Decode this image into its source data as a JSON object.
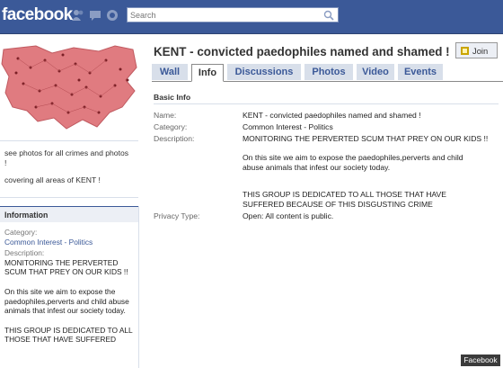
{
  "topbar": {
    "logo": "facebook",
    "search": {
      "placeholder": "Search"
    }
  },
  "sidebar": {
    "description_lines": [
      "see photos for all crimes and photos !",
      "covering all areas of KENT !"
    ],
    "info_heading": "Information",
    "category_label": "Category:",
    "category_value": "Common Interest - Politics",
    "description_label": "Description:",
    "description_paragraphs": [
      "MONITORING THE PERVERTED SCUM THAT PREY ON OUR KIDS !!",
      "On this site we aim to expose the paedophiles,perverts and child abuse animals that infest our society today.",
      "THIS GROUP IS DEDICATED TO ALL THOSE THAT HAVE SUFFERED"
    ]
  },
  "main": {
    "title": "KENT - convicted paedophiles named and shamed !",
    "join_label": "Join",
    "tabs": [
      {
        "label": "Wall"
      },
      {
        "label": "Info"
      },
      {
        "label": "Discussions"
      },
      {
        "label": "Photos"
      },
      {
        "label": "Video"
      },
      {
        "label": "Events"
      }
    ],
    "active_tab": "Info",
    "section_title": "Basic Info",
    "fields": {
      "name_label": "Name:",
      "name_value": "KENT - convicted paedophiles named and shamed !",
      "category_label": "Category:",
      "category_value": "Common Interest - Politics",
      "description_label": "Description:",
      "description_p1": "MONITORING THE PERVERTED SCUM THAT PREY ON OUR KIDS !!",
      "description_p2": "On this site we aim to expose the paedophiles,perverts and child abuse animals that infest our society today.",
      "description_p3": "THIS GROUP IS DEDICATED TO ALL THOSE THAT HAVE SUFFERED BECAUSE OF THIS DISGUSTING CRIME",
      "privacy_label": "Privacy Type:",
      "privacy_value": "Open: All content is public."
    }
  },
  "watermark": "Facebook",
  "colors": {
    "brand": "#3b5998",
    "tab_bg": "#d8dfea",
    "map_fill": "#e07b80"
  },
  "icons": [
    "friends-icon",
    "messages-icon",
    "notifications-icon",
    "search-icon",
    "join-icon"
  ]
}
